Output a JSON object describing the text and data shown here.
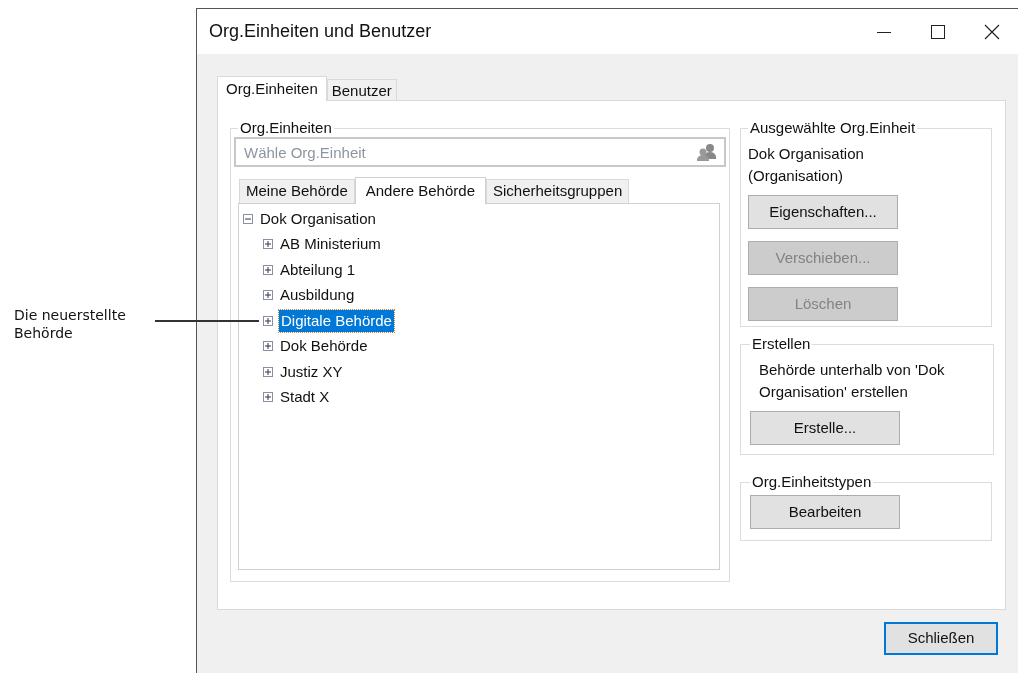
{
  "window": {
    "title": "Org.Einheiten und Benutzer"
  },
  "tabs": [
    {
      "label": "Org.Einheiten",
      "selected": true
    },
    {
      "label": "Benutzer",
      "selected": false
    }
  ],
  "org_units_group": {
    "title": "Org.Einheiten",
    "search": {
      "placeholder": "Wähle Org.Einheit"
    },
    "tabs": [
      {
        "label": "Meine Behörde",
        "selected": false
      },
      {
        "label": "Andere Behörde",
        "selected": true
      },
      {
        "label": "Sicherheitsgruppen",
        "selected": false
      }
    ],
    "tree": [
      {
        "label": "Dok Organisation",
        "expanded": true,
        "selected": false,
        "children": [
          {
            "label": "AB Ministerium",
            "expanded": false,
            "selected": false
          },
          {
            "label": "Abteilung 1",
            "expanded": false,
            "selected": false
          },
          {
            "label": "Ausbildung",
            "expanded": false,
            "selected": false
          },
          {
            "label": "Digitale Behörde",
            "expanded": false,
            "selected": true
          },
          {
            "label": "Dok Behörde",
            "expanded": false,
            "selected": false
          },
          {
            "label": "Justiz XY",
            "expanded": false,
            "selected": false
          },
          {
            "label": "Stadt X",
            "expanded": false,
            "selected": false
          }
        ]
      }
    ]
  },
  "selected_unit_group": {
    "title": "Ausgewählte Org.Einheit",
    "description": "Dok Organisation (Organisation)",
    "buttons": [
      {
        "label": "Eigenschaften...",
        "disabled": false
      },
      {
        "label": "Verschieben...",
        "disabled": true
      },
      {
        "label": "Löschen",
        "disabled": true
      }
    ]
  },
  "create_group": {
    "title": "Erstellen",
    "description": "Behörde unterhalb von 'Dok Organisation' erstellen",
    "buttons": [
      {
        "label": "Erstelle...",
        "disabled": false
      }
    ]
  },
  "types_group": {
    "title": "Org.Einheitstypen",
    "buttons": [
      {
        "label": "Bearbeiten",
        "disabled": false
      }
    ]
  },
  "footer_buttons": [
    {
      "label": "Schließen",
      "default": true
    }
  ],
  "annotation": {
    "text": "Die neuerstellte Behörde"
  }
}
